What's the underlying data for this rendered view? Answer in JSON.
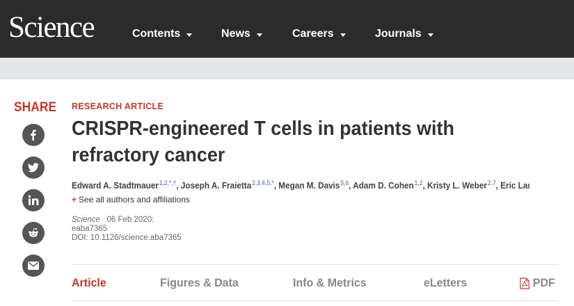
{
  "header": {
    "logo": "Science",
    "nav": [
      {
        "label": "Contents"
      },
      {
        "label": "News"
      },
      {
        "label": "Careers"
      },
      {
        "label": "Journals"
      }
    ]
  },
  "share": {
    "label": "SHARE",
    "buttons": [
      {
        "icon": "facebook-icon"
      },
      {
        "icon": "twitter-icon"
      },
      {
        "icon": "linkedin-icon"
      },
      {
        "icon": "reddit-icon"
      },
      {
        "icon": "email-icon"
      }
    ],
    "button_color": "#555555"
  },
  "article": {
    "kicker": "RESEARCH ARTICLE",
    "title": "CRISPR-engineered T cells in patients with refractory cancer",
    "authors": [
      {
        "name": "Edward A. Stadtmauer",
        "sup": "1,2,*,†"
      },
      {
        "name": "Joseph A. Fraietta",
        "sup": "2,3,4,5,*"
      },
      {
        "name": "Megan M. Davis",
        "sup": "5,6"
      },
      {
        "name": "Adam D. Cohen",
        "sup": "1,2"
      },
      {
        "name": "Kristy L. Weber",
        "sup": "2,7"
      },
      {
        "name": "Eric Lanca...",
        "sup": ""
      }
    ],
    "affiliations_link": "See all authors and affiliations",
    "journal": "Science",
    "date": "06 Feb 2020:",
    "article_id": "eaba7365",
    "doi": "DOI: 10.1126/science.aba7365"
  },
  "tabs": [
    {
      "label": "Article",
      "active": true
    },
    {
      "label": "Figures & Data",
      "active": false
    },
    {
      "label": "Info & Metrics",
      "active": false
    },
    {
      "label": "eLetters",
      "active": false
    },
    {
      "label": "PDF",
      "active": false
    }
  ],
  "colors": {
    "accent": "#c0392b",
    "nav_bg": "#2b2b2b",
    "subbar_bg": "#e4e6e8"
  }
}
